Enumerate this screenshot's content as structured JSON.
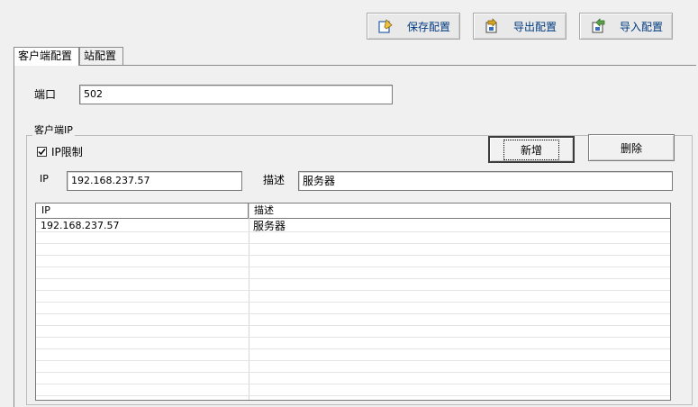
{
  "toolbar": {
    "save_label": "保存配置",
    "export_label": "导出配置",
    "import_label": "导入配置"
  },
  "tabs": [
    {
      "label": "客户端配置",
      "active": true
    },
    {
      "label": "站配置",
      "active": false
    }
  ],
  "port": {
    "label": "端口",
    "value": "502"
  },
  "client_ip_group": {
    "title": "客户端IP",
    "ip_limit": {
      "label": "IP限制",
      "checked": true
    },
    "ip_field": {
      "label": "IP",
      "value": "192.168.237.57"
    },
    "desc_field": {
      "label": "描述",
      "value": "服务器"
    },
    "add_label": "新增",
    "delete_label": "删除"
  },
  "table": {
    "columns": [
      "IP",
      "描述"
    ],
    "rows": [
      {
        "ip": "192.168.237.57",
        "desc": "服务器"
      }
    ]
  },
  "icons": {
    "save": "save-config-icon",
    "export": "export-config-icon",
    "import": "import-config-icon",
    "checkbox": "check-icon"
  },
  "colors": {
    "window_bg": "#f0f0f0",
    "toolbar_text": "#003a80"
  }
}
